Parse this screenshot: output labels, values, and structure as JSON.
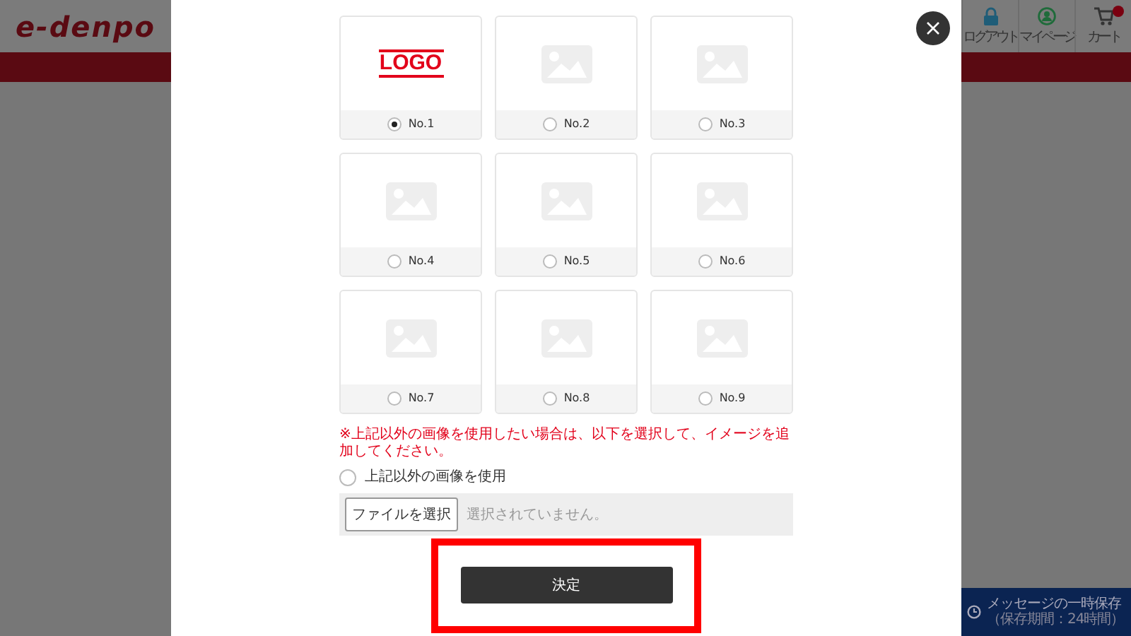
{
  "site": {
    "logo": "e-denpo",
    "header_links": [
      {
        "label": "ログアウト",
        "kind": "logout"
      },
      {
        "label": "マイページ",
        "kind": "mypage"
      },
      {
        "label": "カート",
        "kind": "cart",
        "badge": true
      }
    ]
  },
  "save_panel": {
    "title": "メッセージの一時保存",
    "note": "（保存期間：24時間）"
  },
  "modal": {
    "options": [
      {
        "label": "No.1",
        "selected": true,
        "kind": "logo",
        "logo_text": "LOGO"
      },
      {
        "label": "No.2",
        "selected": false,
        "kind": "placeholder"
      },
      {
        "label": "No.3",
        "selected": false,
        "kind": "placeholder"
      },
      {
        "label": "No.4",
        "selected": false,
        "kind": "placeholder"
      },
      {
        "label": "No.5",
        "selected": false,
        "kind": "placeholder"
      },
      {
        "label": "No.6",
        "selected": false,
        "kind": "placeholder"
      },
      {
        "label": "No.7",
        "selected": false,
        "kind": "placeholder"
      },
      {
        "label": "No.8",
        "selected": false,
        "kind": "placeholder"
      },
      {
        "label": "No.9",
        "selected": false,
        "kind": "placeholder"
      }
    ],
    "notice": "※上記以外の画像を使用したい場合は、以下を選択して、イメージを追加してください。",
    "custom_option": {
      "label": "上記以外の画像を使用",
      "selected": false
    },
    "file_button": "ファイルを選択",
    "file_status": "選択されていません。",
    "submit": "決定",
    "highlight_submit": true
  }
}
